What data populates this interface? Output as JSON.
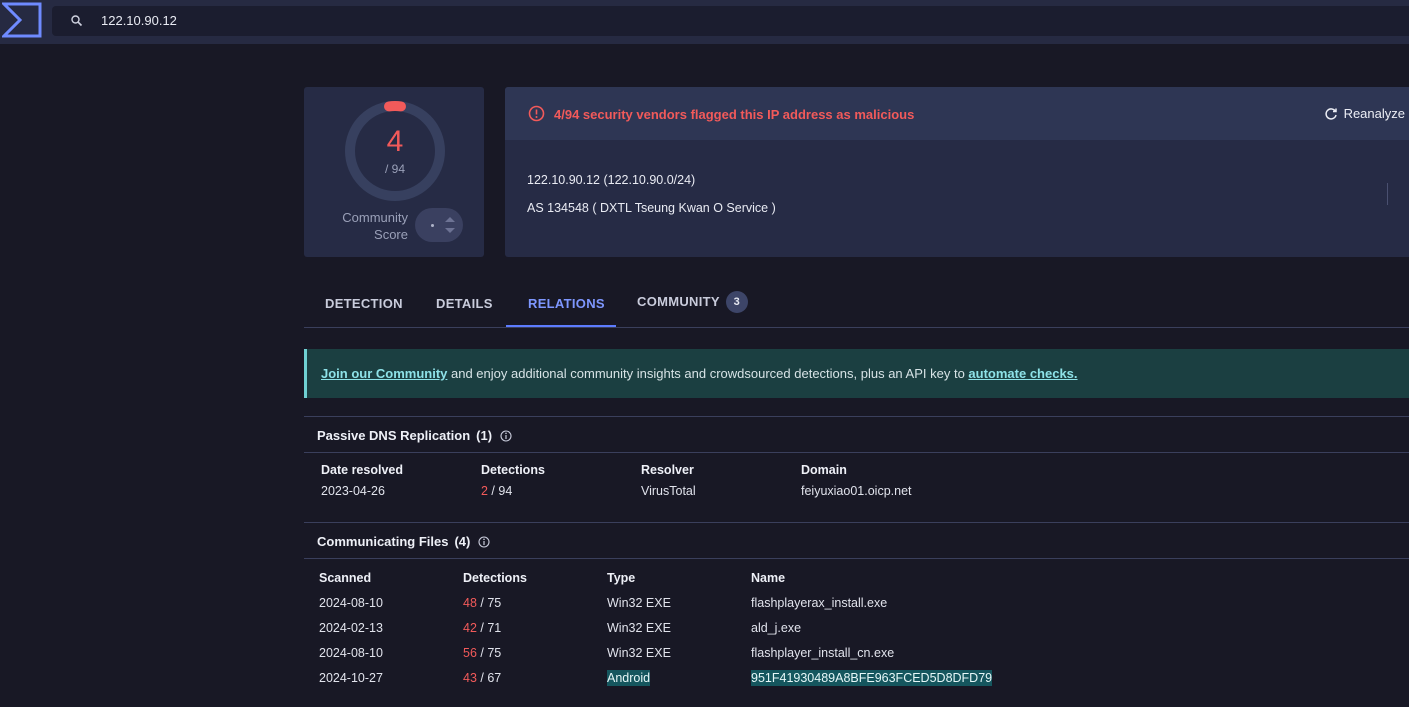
{
  "search": {
    "value": "122.10.90.12"
  },
  "score": {
    "detections": "4",
    "total": "/ 94",
    "community_label": "Community Score"
  },
  "alert": {
    "text": "4/94 security vendors flagged this IP address as malicious",
    "reanalyze": "Reanalyze"
  },
  "ip": {
    "line": "122.10.90.12  (122.10.90.0/24)",
    "as_line": "AS 134548  ( DXTL Tseung Kwan O Service )"
  },
  "tabs": [
    {
      "label": "DETECTION"
    },
    {
      "label": "DETAILS"
    },
    {
      "label": "RELATIONS"
    },
    {
      "label": "COMMUNITY",
      "badge": "3"
    }
  ],
  "banner": {
    "link1": "Join our Community",
    "middle": " and enjoy additional community insights and crowdsourced detections, plus an API key to ",
    "link2": "automate checks."
  },
  "passive_dns": {
    "title": "Passive DNS Replication",
    "count": "(1)",
    "headers": [
      "Date resolved",
      "Detections",
      "Resolver",
      "Domain"
    ],
    "rows": [
      {
        "date": "2023-04-26",
        "det": "2",
        "det_total": " / 94",
        "resolver": "VirusTotal",
        "domain": "feiyuxiao01.oicp.net"
      }
    ]
  },
  "files": {
    "title": "Communicating Files",
    "count": "(4)",
    "headers": [
      "Scanned",
      "Detections",
      "Type",
      "Name"
    ],
    "rows": [
      {
        "scanned": "2024-08-10",
        "det": "48",
        "det_total": " / 75",
        "type": "Win32 EXE",
        "name": "flashplayerax_install.exe"
      },
      {
        "scanned": "2024-02-13",
        "det": "42",
        "det_total": " / 71",
        "type": "Win32 EXE",
        "name": "ald_j.exe"
      },
      {
        "scanned": "2024-08-10",
        "det": "56",
        "det_total": " / 75",
        "type": "Win32 EXE",
        "name": "flashplayer_install_cn.exe"
      },
      {
        "scanned": "2024-10-27",
        "det": "43",
        "det_total": " / 67",
        "type": "Android",
        "name": "951F41930489A8BFE963FCED5D8DFD79"
      }
    ]
  },
  "colors": {
    "malicious": "#f25a5a",
    "accent": "#5d7cff",
    "banner_bg": "#1b3f41"
  }
}
